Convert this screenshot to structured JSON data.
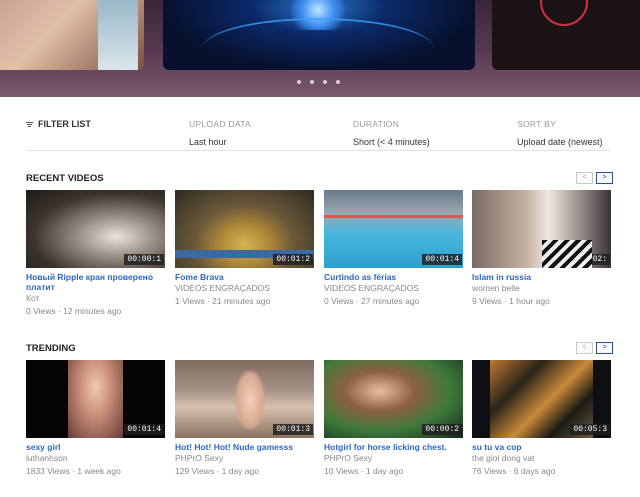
{
  "carousel": {
    "dots": [
      "slide-1",
      "slide-2",
      "slide-3",
      "slide-4"
    ]
  },
  "filters": {
    "toggle_label": "FILTER LIST",
    "upload": {
      "label": "UPLOAD DATA",
      "value": "Last hour"
    },
    "duration": {
      "label": "DURATION",
      "value": "Short (< 4 minutes)"
    },
    "sort": {
      "label": "SORT BY",
      "value": "Upload date (newest)"
    }
  },
  "sections": [
    {
      "title": "RECENT VIDEOS",
      "prev": "<",
      "next": ">",
      "videos": [
        {
          "title": "Новый Ripple кран проверено платит",
          "author": "Кот",
          "meta": "0 Views · 12 minutes ago",
          "duration": "00:00:1"
        },
        {
          "title": "Fome Brava",
          "author": "VIDEOS ENGRAÇADOS",
          "meta": "1 Views · 21 minutes ago",
          "duration": "00:01:2"
        },
        {
          "title": "Curtindo as férias",
          "author": "VIDEOS ENGRAÇADOS",
          "meta": "0 Views · 27 minutes ago",
          "duration": "00:01:4"
        },
        {
          "title": "Islam in russia",
          "author": "women belle",
          "meta": "9 Views · 1 hour ago",
          "duration": "00:02:"
        }
      ]
    },
    {
      "title": "TRENDING",
      "prev": "<",
      "next": ">",
      "videos": [
        {
          "title": "sexy girl",
          "author": "luthanhson",
          "meta": "1833 Views · 1 week ago",
          "duration": "00:01:4"
        },
        {
          "title": "Hot! Hot! Hot! Nude gamesss",
          "author": "PHPrO Sexy",
          "meta": "129 Views · 1 day ago",
          "duration": "00:01:3"
        },
        {
          "title": "Hotgirl for horse licking chest.",
          "author": "PHPrO Sexy",
          "meta": "10 Views · 1 day ago",
          "duration": "00:00:2"
        },
        {
          "title": "su tu va cop",
          "author": "the gioi dong vat",
          "meta": "76 Views · 6 days ago",
          "duration": "00:05:3"
        }
      ]
    }
  ]
}
